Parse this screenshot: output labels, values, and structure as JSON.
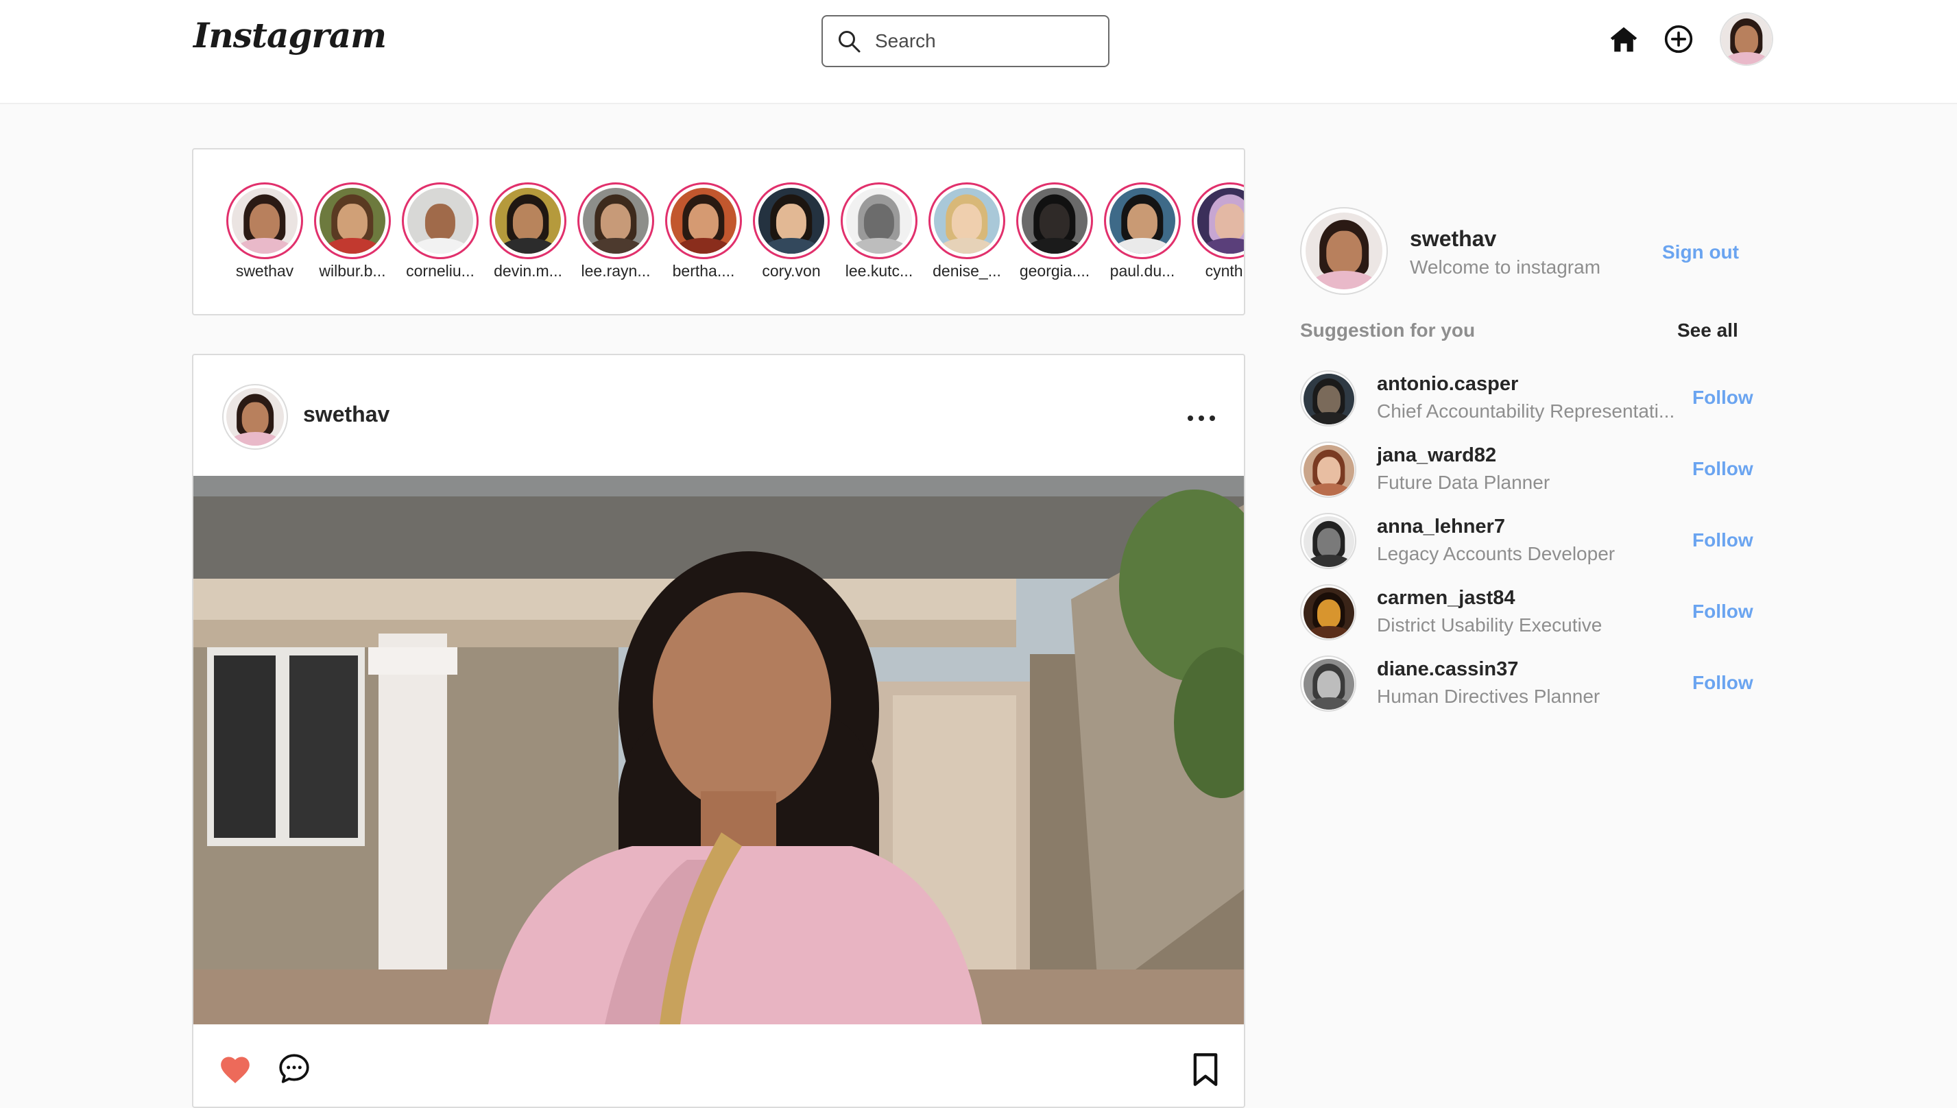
{
  "header": {
    "logo": "Instagram",
    "search_placeholder": "Search",
    "icons": [
      "home-icon",
      "plus-circle-icon",
      "profile-avatar"
    ]
  },
  "stories": [
    {
      "username": "swethav"
    },
    {
      "username": "wilbur.b..."
    },
    {
      "username": "corneliu..."
    },
    {
      "username": "devin.m..."
    },
    {
      "username": "lee.rayn..."
    },
    {
      "username": "bertha...."
    },
    {
      "username": "cory.von"
    },
    {
      "username": "lee.kutc..."
    },
    {
      "username": "denise_..."
    },
    {
      "username": "georgia...."
    },
    {
      "username": "paul.du..."
    },
    {
      "username": "cynthia"
    }
  ],
  "post": {
    "username": "swethav",
    "icons": [
      "more-options-icon",
      "heart-icon",
      "comment-icon",
      "bookmark-icon"
    ],
    "liked": true
  },
  "sidebar": {
    "me": {
      "username": "swethav",
      "subtitle": "Welcome to instagram",
      "signout_label": "Sign out"
    },
    "suggestions_title": "Suggestion for you",
    "see_all_label": "See all",
    "suggestions": [
      {
        "username": "antonio.casper",
        "role": "Chief Accountability Representati...",
        "follow_label": "Follow"
      },
      {
        "username": "jana_ward82",
        "role": "Future Data Planner",
        "follow_label": "Follow"
      },
      {
        "username": "anna_lehner7",
        "role": "Legacy Accounts Developer",
        "follow_label": "Follow"
      },
      {
        "username": "carmen_jast84",
        "role": "District Usability Executive",
        "follow_label": "Follow"
      },
      {
        "username": "diane.cassin37",
        "role": "Human Directives Planner",
        "follow_label": "Follow"
      }
    ]
  },
  "colors": {
    "story_ring": "#e1306c",
    "link_blue": "#6aa4f0",
    "heart_red": "#ed4956",
    "muted_text": "#8e8e8e"
  }
}
